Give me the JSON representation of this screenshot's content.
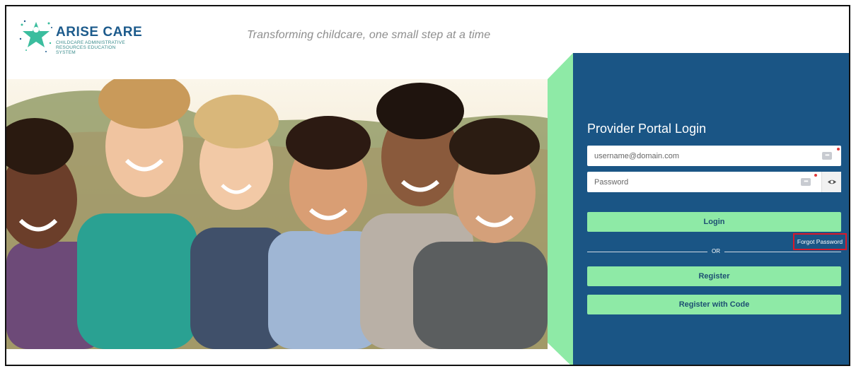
{
  "brand": {
    "name": "ARISE CARE",
    "subtitle": "CHILDCARE ADMINISTRATIVE RESOURCES EDUCATION SYSTEM",
    "tagline": "Transforming childcare, one small step at a time"
  },
  "login": {
    "title": "Provider Portal Login",
    "username_placeholder": "username@domain.com",
    "username_value": "",
    "password_placeholder": "Password",
    "password_value": "",
    "login_label": "Login",
    "forgot_label": "Forgot Password",
    "or_label": "OR",
    "register_label": "Register",
    "register_code_label": "Register with Code"
  },
  "icons": {
    "logo": "star-children-logo-icon",
    "username_key": "password-manager-icon",
    "password_key": "password-manager-icon",
    "show_password": "eye-icon"
  },
  "colors": {
    "panel": "#1a5585",
    "accent_green": "#8eeaa6",
    "brand_blue": "#1d5b8c",
    "highlight": "#d8192a"
  }
}
